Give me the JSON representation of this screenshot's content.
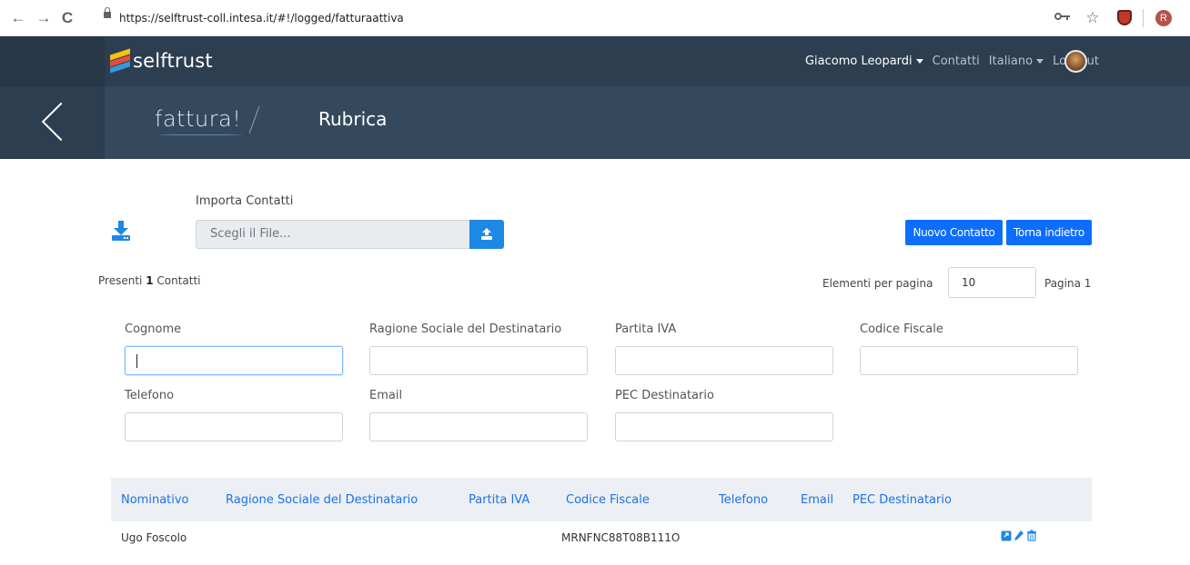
{
  "browser": {
    "back": "←",
    "forward": "→",
    "reload": "C",
    "url": "https://selftrust-coll.intesa.it/#!/logged/fatturaattiva",
    "key_icon": "key-icon",
    "star": "☆",
    "profile_initial": "R"
  },
  "topnav": {
    "logo_text": "selftrust",
    "user": "Giacomo Leopardi",
    "contatti": "Contatti",
    "language": "Italiano",
    "logout": "Log Out",
    "bg_color": "#2c3e50"
  },
  "subheader": {
    "brand": "fattura!",
    "title": "Rubrica",
    "bg_color": "#34495e"
  },
  "import": {
    "label": "Importa Contatti",
    "file_placeholder": "Scegli il File..."
  },
  "actions": {
    "new_contact": "Nuovo Contatto",
    "go_back": "Torna indietro",
    "accent": "#0d6efd"
  },
  "summary": {
    "prefix": "Presenti",
    "count": "1",
    "suffix": "Contatti",
    "per_page_label": "Elementi per pagina",
    "per_page_value": "10",
    "page_label": "Pagina 1"
  },
  "filters": {
    "cognome": "Cognome",
    "ragione_sociale": "Ragione Sociale del Destinatario",
    "partita_iva": "Partita IVA",
    "codice_fiscale": "Codice Fiscale",
    "telefono": "Telefono",
    "email": "Email",
    "pec": "PEC Destinatario"
  },
  "table": {
    "headers": {
      "nominativo": "Nominativo",
      "ragione_sociale": "Ragione Sociale del Destinatario",
      "partita_iva": "Partita IVA",
      "codice_fiscale": "Codice Fiscale",
      "telefono": "Telefono",
      "email": "Email",
      "pec": "PEC Destinatario"
    },
    "rows": [
      {
        "nominativo": "Ugo Foscolo",
        "ragione_sociale": "",
        "partita_iva": "",
        "codice_fiscale": "MRNFNC88T08B111O",
        "telefono": "",
        "email": "",
        "pec": "",
        "actions": [
          "view-icon",
          "edit-icon",
          "delete-icon"
        ]
      }
    ]
  }
}
